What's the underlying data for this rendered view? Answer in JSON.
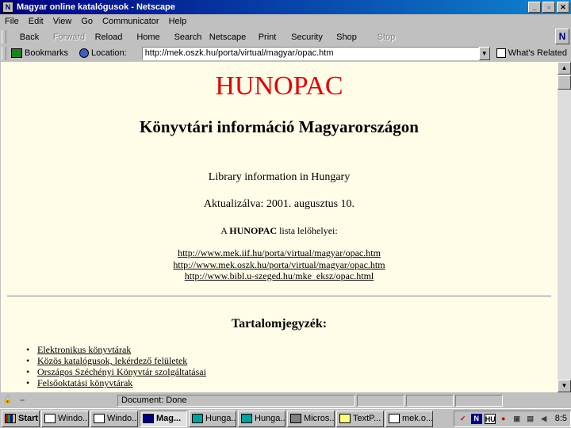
{
  "window": {
    "title": "Magyar online katalógusok - Netscape"
  },
  "menu": [
    "File",
    "Edit",
    "View",
    "Go",
    "Communicator",
    "Help"
  ],
  "nav_toolbar": [
    {
      "label": "Back",
      "enabled": true
    },
    {
      "label": "Forward",
      "enabled": false
    },
    {
      "label": "Reload",
      "enabled": true
    },
    {
      "label": "Home",
      "enabled": true
    },
    {
      "label": "Search",
      "enabled": true
    },
    {
      "label": "Netscape",
      "enabled": true
    },
    {
      "label": "Print",
      "enabled": true
    },
    {
      "label": "Security",
      "enabled": true
    },
    {
      "label": "Shop",
      "enabled": true
    },
    {
      "label": "Stop",
      "enabled": false
    }
  ],
  "location_bar": {
    "bookmarks_label": "Bookmarks",
    "location_label": "Location:",
    "url": "http://mek.oszk.hu/porta/virtual/magyar/opac.htm",
    "related_label": "What's Related"
  },
  "page": {
    "heading": "HUNOPAC",
    "subtitle": "Könyvtári információ Magyarországon",
    "english_title": "Library information in Hungary",
    "updated_label": "Aktualizálva:",
    "updated_date": "2001. augusztus 10.",
    "sites_text_before": "A ",
    "sites_text_bold": "HUNOPAC",
    "sites_text_after": " lista lelőhelyei:",
    "mirror_links": [
      "http://www.mek.iif.hu/porta/virtual/magyar/opac.htm",
      "http://www.mek.oszk.hu/porta/virtual/magyar/opac.htm",
      "http://www.bibl.u-szeged.hu/mke_eksz/opac.html"
    ],
    "toc_heading": "Tartalomjegyzék:",
    "toc_items": [
      "Elektronikus könyvtárak",
      "Közös katalógusok, lekérdező felületek",
      "Országos Széchényi Könyvtár szolgáltatásai",
      "Felsőoktatási könyvtárak"
    ]
  },
  "status": {
    "text": "Document: Done"
  },
  "taskbar": {
    "start_label": "Start",
    "tasks": [
      {
        "label": "Windo...",
        "active": false
      },
      {
        "label": "Windo...",
        "active": false
      },
      {
        "label": "Mag...",
        "active": true
      },
      {
        "label": "Hunga...",
        "active": false
      },
      {
        "label": "Hunga...",
        "active": false
      },
      {
        "label": "Micros...",
        "active": false
      },
      {
        "label": "TextP...",
        "active": false
      },
      {
        "label": "mek.o...",
        "active": false
      }
    ],
    "tray_icons": [
      "N",
      "HU"
    ],
    "clock": "8:5"
  }
}
